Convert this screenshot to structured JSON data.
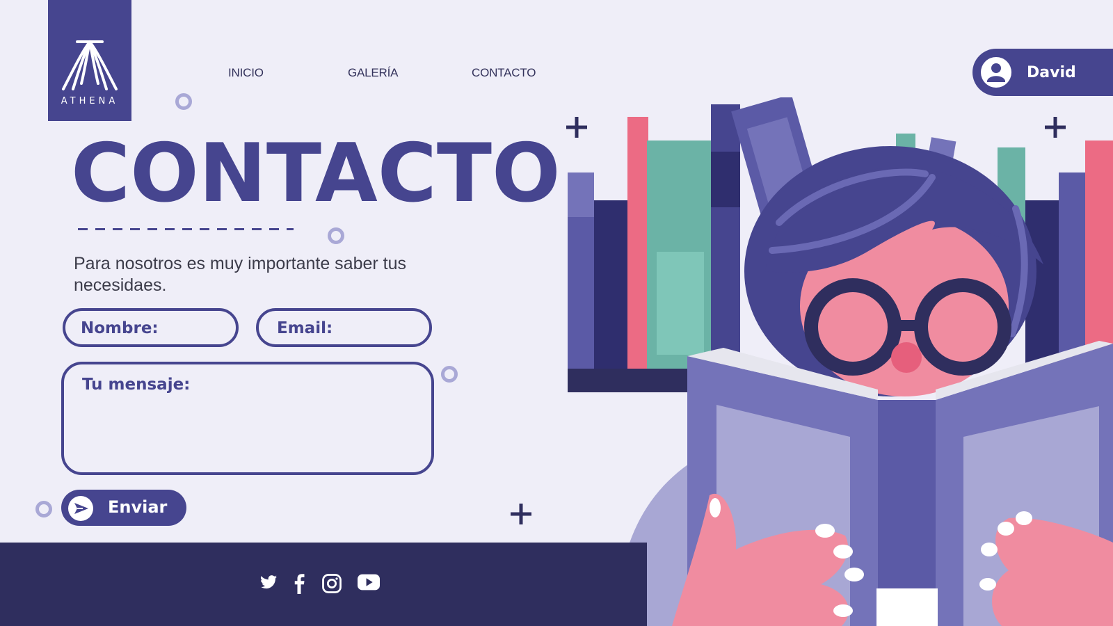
{
  "logo": {
    "text": "ATHENA",
    "icon": "athena-pillars-icon"
  },
  "nav": {
    "items": [
      "INICIO",
      "GALERÍA",
      "CONTACTO"
    ]
  },
  "user": {
    "name": "David",
    "icon": "user-avatar-icon"
  },
  "page": {
    "title": "CONTACTO",
    "description": "Para nosotros es muy importante saber tus necesidaes."
  },
  "form": {
    "name_label": "Nombre:",
    "email_label": "Email:",
    "message_label": "Tu mensaje:",
    "send_label": "Enviar",
    "send_icon": "send-icon"
  },
  "footer": {
    "social_icons": [
      "twitter-icon",
      "facebook-icon",
      "instagram-icon",
      "youtube-icon"
    ]
  },
  "colors": {
    "primary": "#46458f",
    "dark": "#2f2e5e",
    "background": "#efeef8",
    "accent_pink": "#ec6b84",
    "accent_green": "#6bb3a6"
  }
}
